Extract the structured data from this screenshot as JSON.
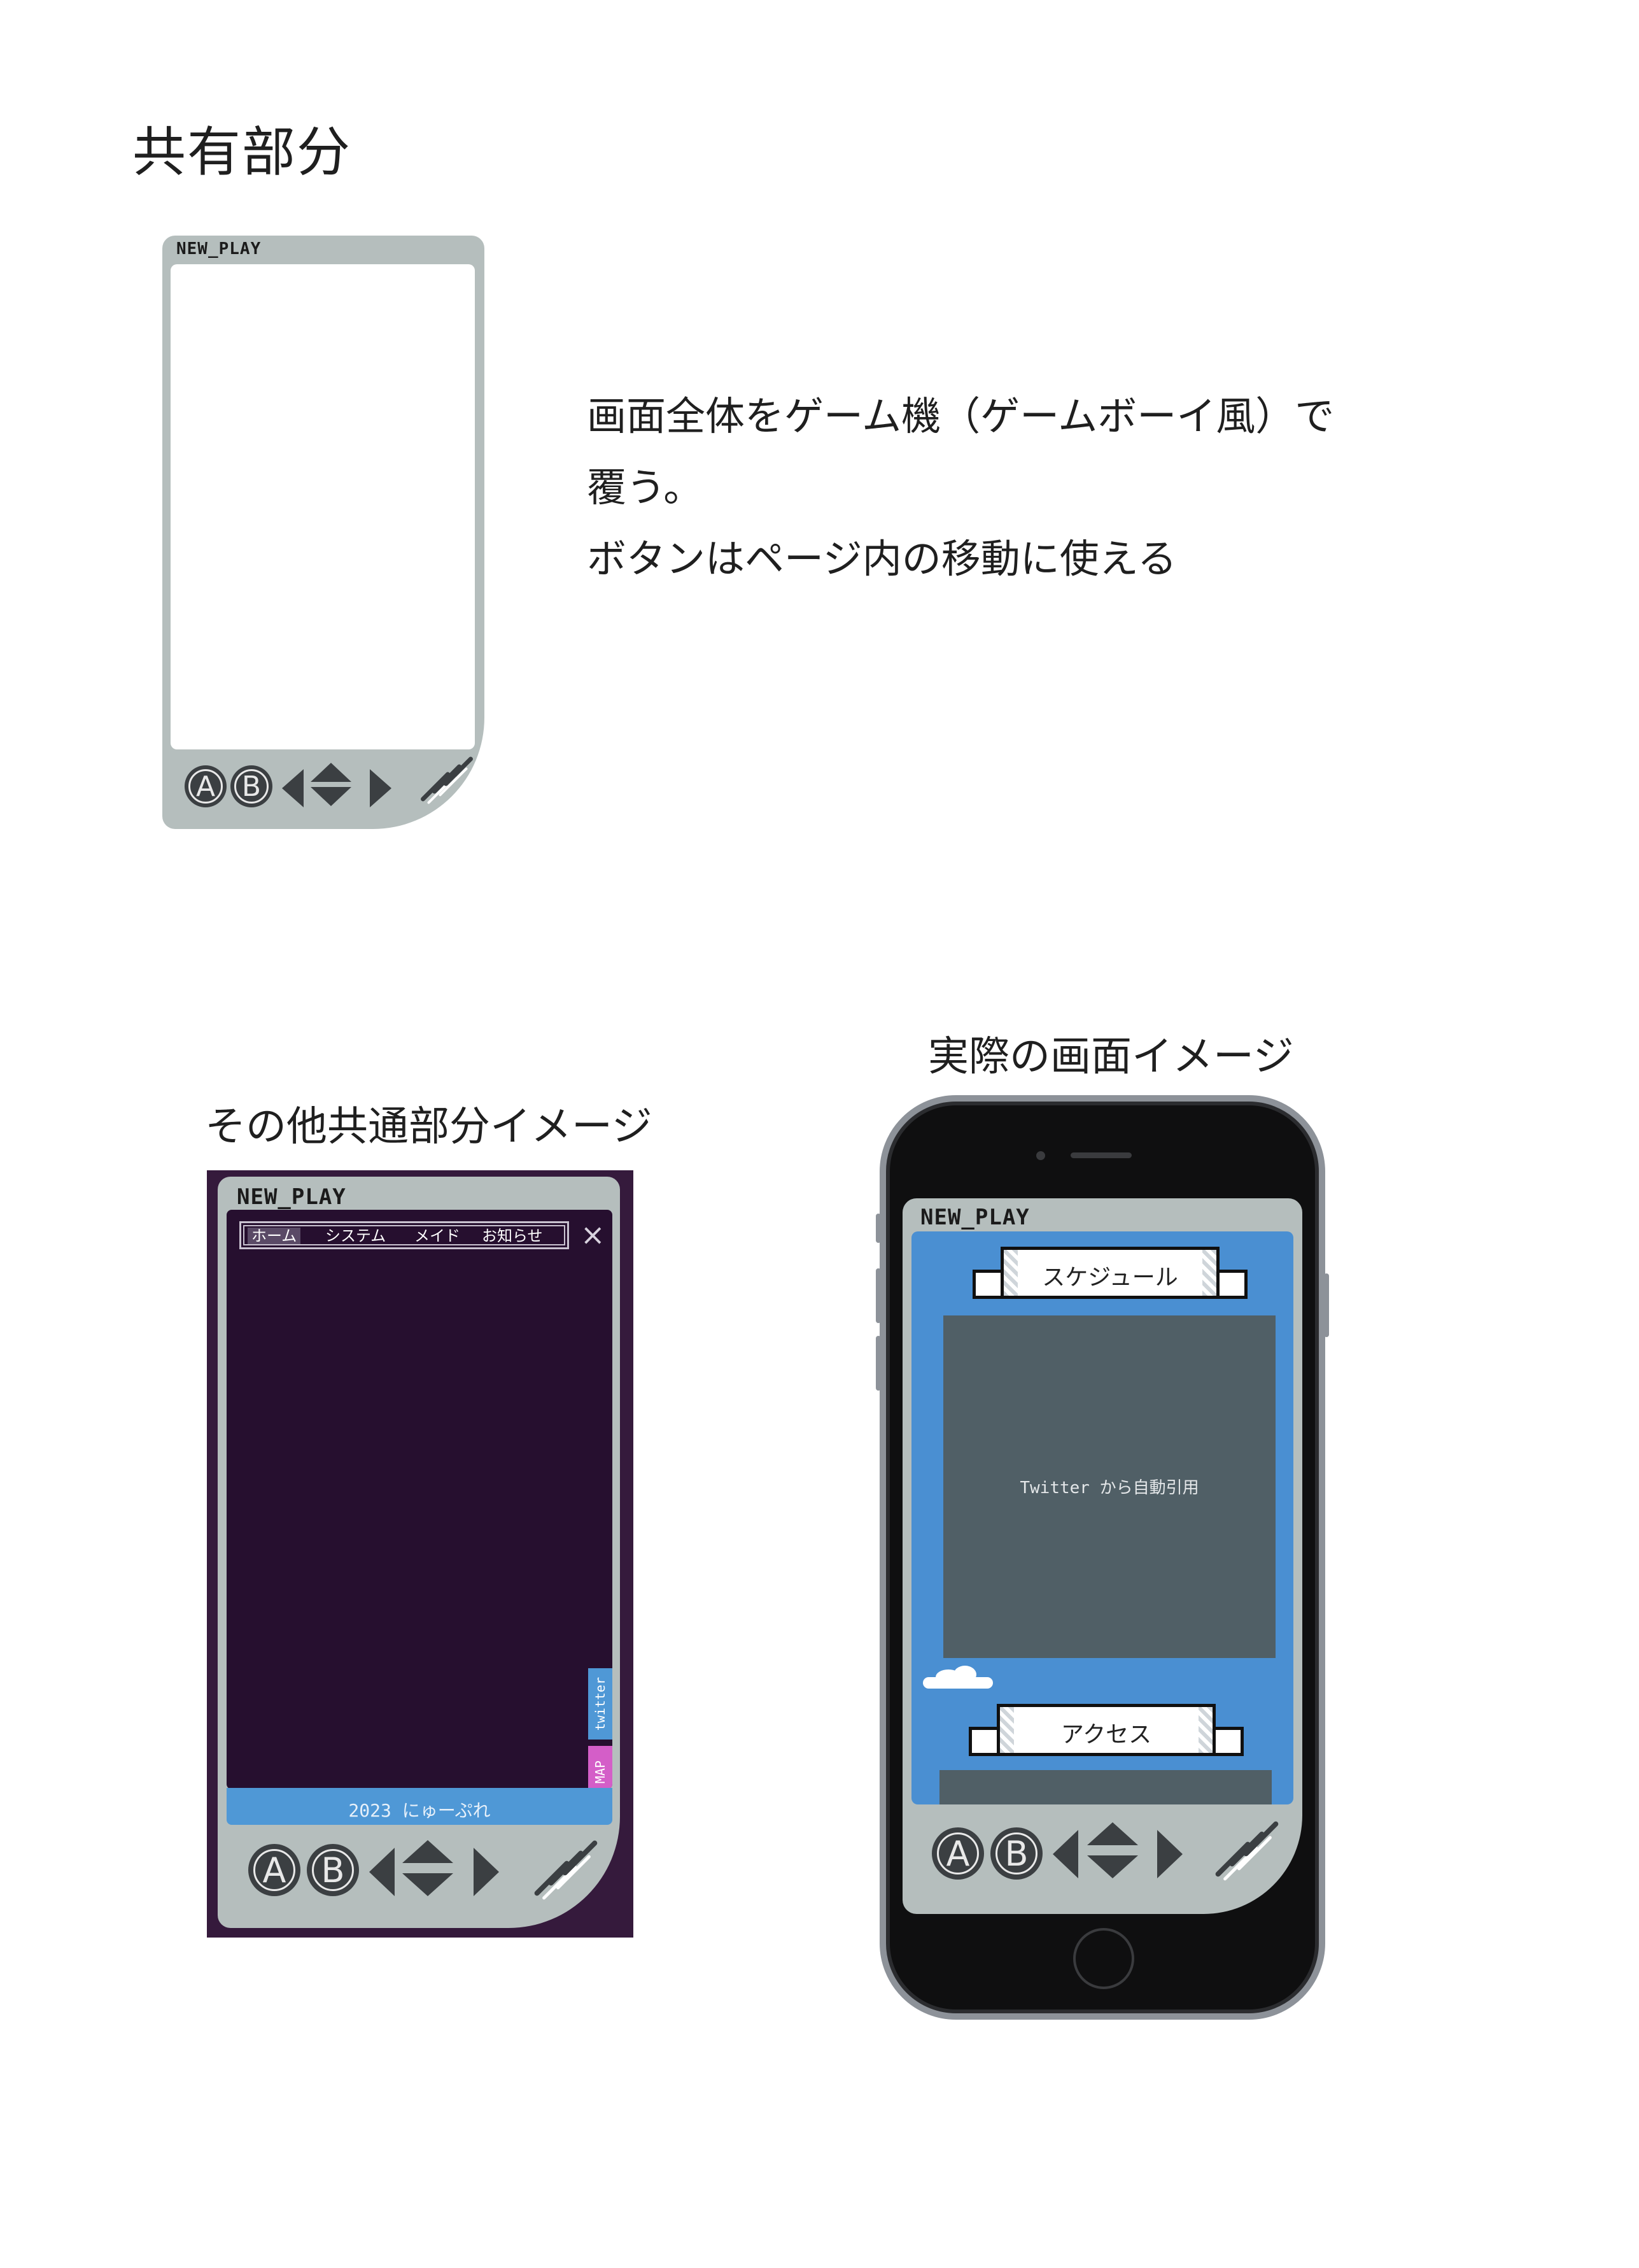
{
  "section_title": "共有部分",
  "description_lines": [
    "画面全体をゲーム機（ゲームボーイ風）で",
    "覆う。",
    "ボタンはページ内の移動に使える"
  ],
  "caption_other": "その他共通部分イメージ",
  "caption_actual": "実際の画面イメージ",
  "logo": "NEW_PLAY",
  "buttons": {
    "a": "A",
    "b": "B"
  },
  "nav": {
    "items": [
      "ホーム",
      "システム",
      "メイド",
      "お知らせ"
    ],
    "active": "ホーム",
    "close_icon": "×"
  },
  "side_tabs": {
    "twitter": "twitter",
    "map": "MAP"
  },
  "footer_text": "2023 にゅーぷれ",
  "actual_screen": {
    "banner_schedule": "スケジュール",
    "twitter_placeholder": "Twitter から自動引用",
    "banner_access": "アクセス"
  },
  "colors": {
    "device_body": "#b5bebd",
    "buttons": "#3b3f42",
    "dark_screen": "#260f2f",
    "dark_bg": "#351a3c",
    "footer_blue": "#4f98d6",
    "twitter_tab": "#4f98d6",
    "map_tab": "#d45ec8",
    "phone_screen_bg": "#4a8fd2",
    "content_grey": "#505f66"
  },
  "icons": [
    "close-icon",
    "dpad-left-icon",
    "dpad-up-icon",
    "dpad-down-icon",
    "dpad-right-icon",
    "speaker-grille-icon",
    "cloud-icon"
  ]
}
